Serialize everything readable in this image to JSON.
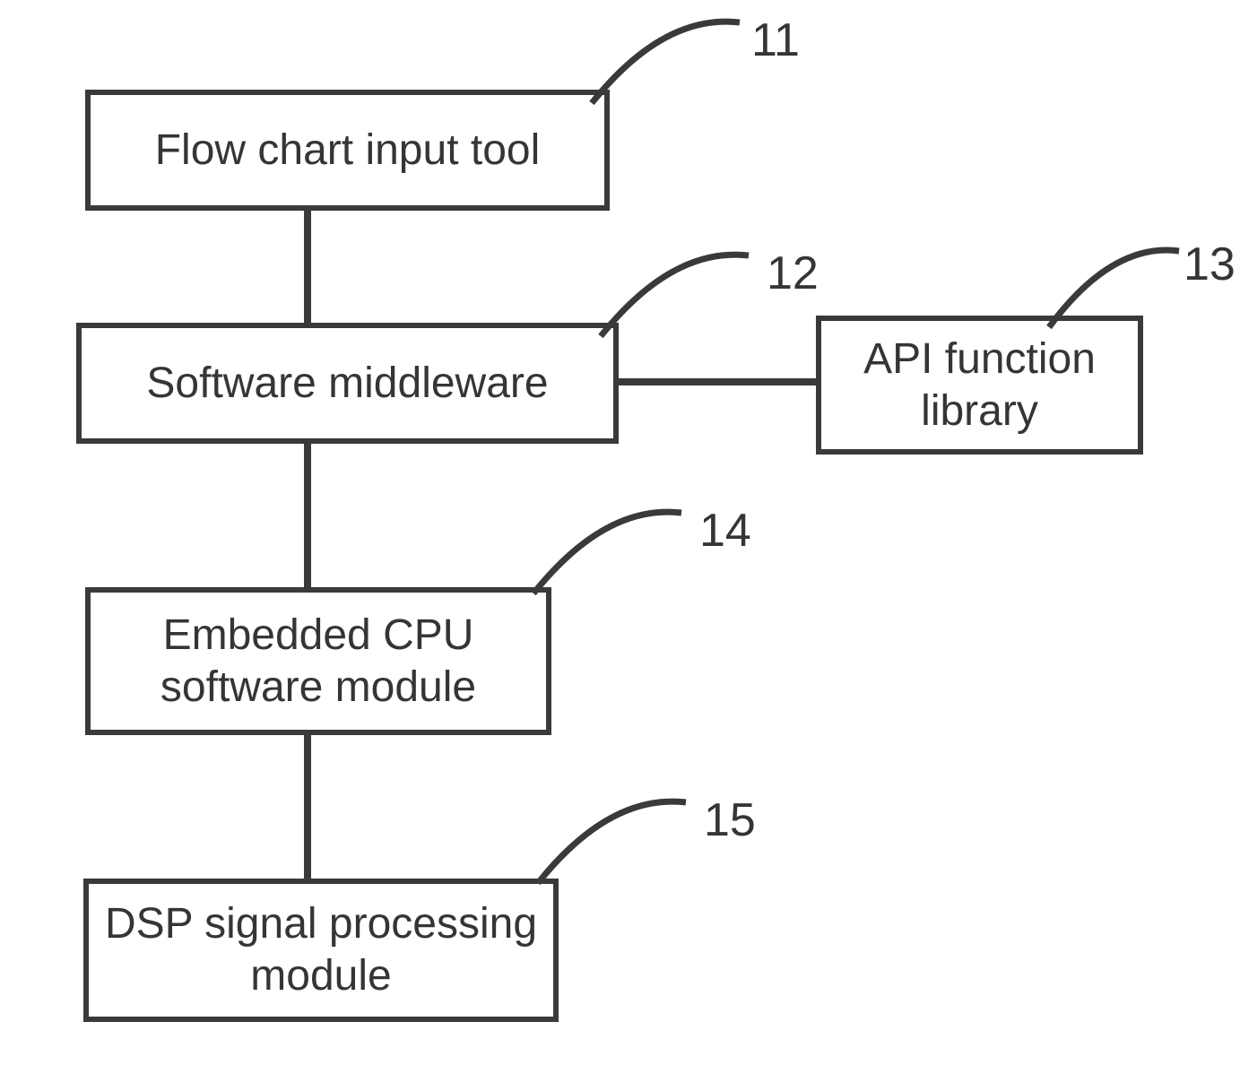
{
  "nodes": {
    "box11": {
      "label": "Flow chart input tool",
      "ref": "11"
    },
    "box12": {
      "label": "Software middleware",
      "ref": "12"
    },
    "box13": {
      "label": "API function library",
      "ref": "13"
    },
    "box14": {
      "label": "Embedded CPU software module",
      "ref": "14"
    },
    "box15": {
      "label": "DSP signal processing module",
      "ref": "15"
    }
  }
}
